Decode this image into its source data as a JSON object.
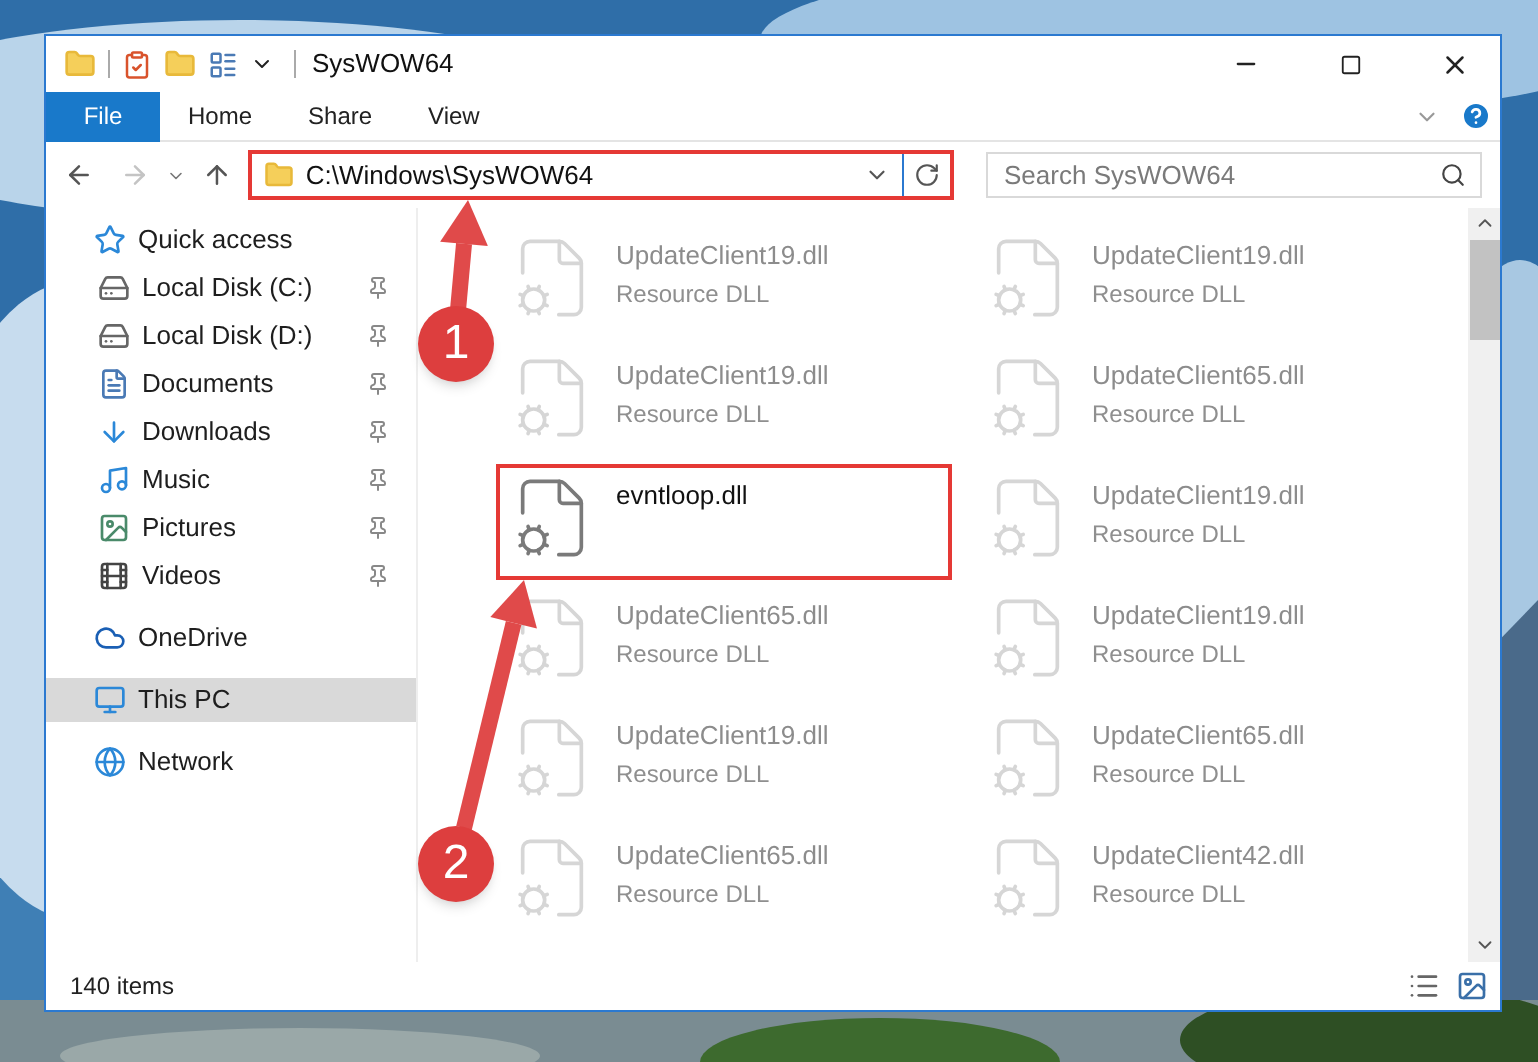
{
  "window": {
    "title": "SysWOW64"
  },
  "ribbon_tabs": [
    {
      "label": "File",
      "kind": "file"
    },
    {
      "label": "Home",
      "kind": "tab"
    },
    {
      "label": "Share",
      "kind": "tab"
    },
    {
      "label": "View",
      "kind": "tab"
    }
  ],
  "address_bar": {
    "path": "C:\\Windows\\SysWOW64",
    "highlighted": true
  },
  "search": {
    "placeholder": "Search SysWOW64"
  },
  "sidebar": {
    "items": [
      {
        "label": "Quick access",
        "kind": "star",
        "selected": false,
        "children": [
          {
            "label": "Local Disk (C:)",
            "kind": "disk",
            "pinned": true,
            "selected": false
          },
          {
            "label": "Local Disk (D:)",
            "kind": "disk",
            "pinned": true,
            "selected": false
          },
          {
            "label": "Documents",
            "kind": "documents",
            "pinned": true,
            "selected": false
          },
          {
            "label": "Downloads",
            "kind": "downloads",
            "pinned": true,
            "selected": false
          },
          {
            "label": "Music",
            "kind": "music",
            "pinned": true,
            "selected": false
          },
          {
            "label": "Pictures",
            "kind": "pictures",
            "pinned": true,
            "selected": false
          },
          {
            "label": "Videos",
            "kind": "videos",
            "pinned": true,
            "selected": false
          }
        ]
      },
      {
        "label": "OneDrive",
        "kind": "cloud",
        "selected": false
      },
      {
        "label": "This PC",
        "kind": "pc",
        "selected": true
      },
      {
        "label": "Network",
        "kind": "network",
        "selected": false
      }
    ]
  },
  "files": [
    {
      "name": "UpdateClient19.dll",
      "type": "Resource DLL",
      "dimmed": true,
      "highlighted": false
    },
    {
      "name": "UpdateClient19.dll",
      "type": "Resource DLL",
      "dimmed": true,
      "highlighted": false
    },
    {
      "name": "UpdateClient19.dll",
      "type": "Resource DLL",
      "dimmed": true,
      "highlighted": false
    },
    {
      "name": "UpdateClient65.dll",
      "type": "Resource DLL",
      "dimmed": true,
      "highlighted": false
    },
    {
      "name": "evntloop.dll",
      "dimmed": false,
      "highlighted": true
    },
    {
      "name": "UpdateClient19.dll",
      "type": "Resource DLL",
      "dimmed": true,
      "highlighted": false
    },
    {
      "name": "UpdateClient65.dll",
      "type": "Resource DLL",
      "dimmed": true,
      "highlighted": false
    },
    {
      "name": "UpdateClient19.dll",
      "type": "Resource DLL",
      "dimmed": true,
      "highlighted": false
    },
    {
      "name": "UpdateClient19.dll",
      "type": "Resource DLL",
      "dimmed": true,
      "highlighted": false
    },
    {
      "name": "UpdateClient65.dll",
      "type": "Resource DLL",
      "dimmed": true,
      "highlighted": false
    },
    {
      "name": "UpdateClient65.dll",
      "type": "Resource DLL",
      "dimmed": true,
      "highlighted": false
    },
    {
      "name": "UpdateClient42.dll",
      "type": "Resource DLL",
      "dimmed": true,
      "highlighted": false
    }
  ],
  "status_bar": {
    "item_count": "140 items"
  },
  "annotations": [
    {
      "label": "1"
    },
    {
      "label": "2"
    }
  ]
}
